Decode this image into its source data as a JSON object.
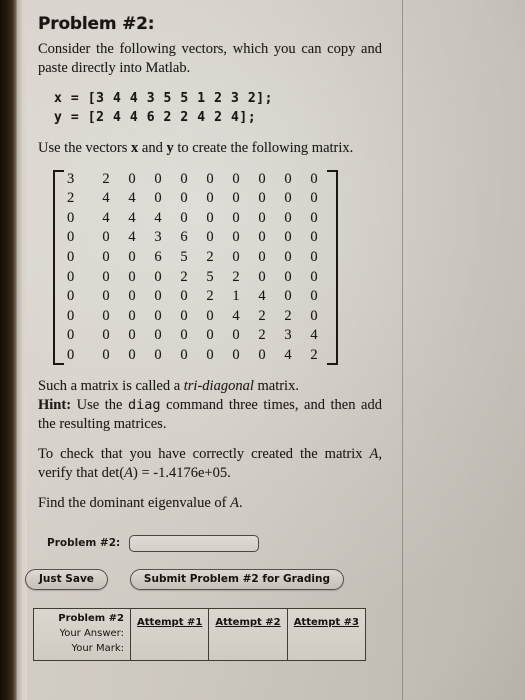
{
  "problem": {
    "title": "Problem #2:",
    "intro": "Consider the following vectors, which you can copy and paste directly into Matlab.",
    "code_x": "x = [3 4 4 3 5 5 1 2 3 2];",
    "code_y": "y = [2 4 4 6 2 2 4 2 4];",
    "instruction_pre": "Use the vectors ",
    "instruction_var1": "x",
    "instruction_mid": " and ",
    "instruction_var2": "y",
    "instruction_post": " to create the following matrix.",
    "caption_pre": "Such a matrix is called a ",
    "caption_em": "tri-diagonal",
    "caption_post": " matrix.",
    "hint_label": "Hint:",
    "hint_pre": " Use the ",
    "hint_code": "diag",
    "hint_post": " command three times, and then add the resulting matrices.",
    "verify_pre": "To check that you have correctly created the matrix ",
    "verify_var": "A",
    "verify_mid": ", verify that det(",
    "verify_var2": "A",
    "verify_value": ") = -1.4176e+05.",
    "question_pre": "Find the dominant eigenvalue of ",
    "question_var": "A",
    "question_post": "."
  },
  "matrix": {
    "rows": [
      [
        3,
        2,
        0,
        0,
        0,
        0,
        0,
        0,
        0,
        0
      ],
      [
        2,
        4,
        4,
        0,
        0,
        0,
        0,
        0,
        0,
        0
      ],
      [
        0,
        4,
        4,
        4,
        0,
        0,
        0,
        0,
        0,
        0
      ],
      [
        0,
        0,
        4,
        3,
        6,
        0,
        0,
        0,
        0,
        0
      ],
      [
        0,
        0,
        0,
        6,
        5,
        2,
        0,
        0,
        0,
        0
      ],
      [
        0,
        0,
        0,
        0,
        2,
        5,
        2,
        0,
        0,
        0
      ],
      [
        0,
        0,
        0,
        0,
        0,
        2,
        1,
        4,
        0,
        0
      ],
      [
        0,
        0,
        0,
        0,
        0,
        0,
        4,
        2,
        2,
        0
      ],
      [
        0,
        0,
        0,
        0,
        0,
        0,
        0,
        2,
        3,
        4
      ],
      [
        0,
        0,
        0,
        0,
        0,
        0,
        0,
        0,
        4,
        2
      ]
    ]
  },
  "answer_form": {
    "label": "Problem #2:",
    "value": "",
    "placeholder": ""
  },
  "buttons": {
    "just_save": "Just Save",
    "submit": "Submit Problem #2 for Grading"
  },
  "attempts_table": {
    "meta": [
      "Problem #2",
      "Your Answer:",
      "Your Mark:"
    ],
    "columns": [
      "Attempt #1",
      "Attempt #2",
      "Attempt #3"
    ]
  }
}
